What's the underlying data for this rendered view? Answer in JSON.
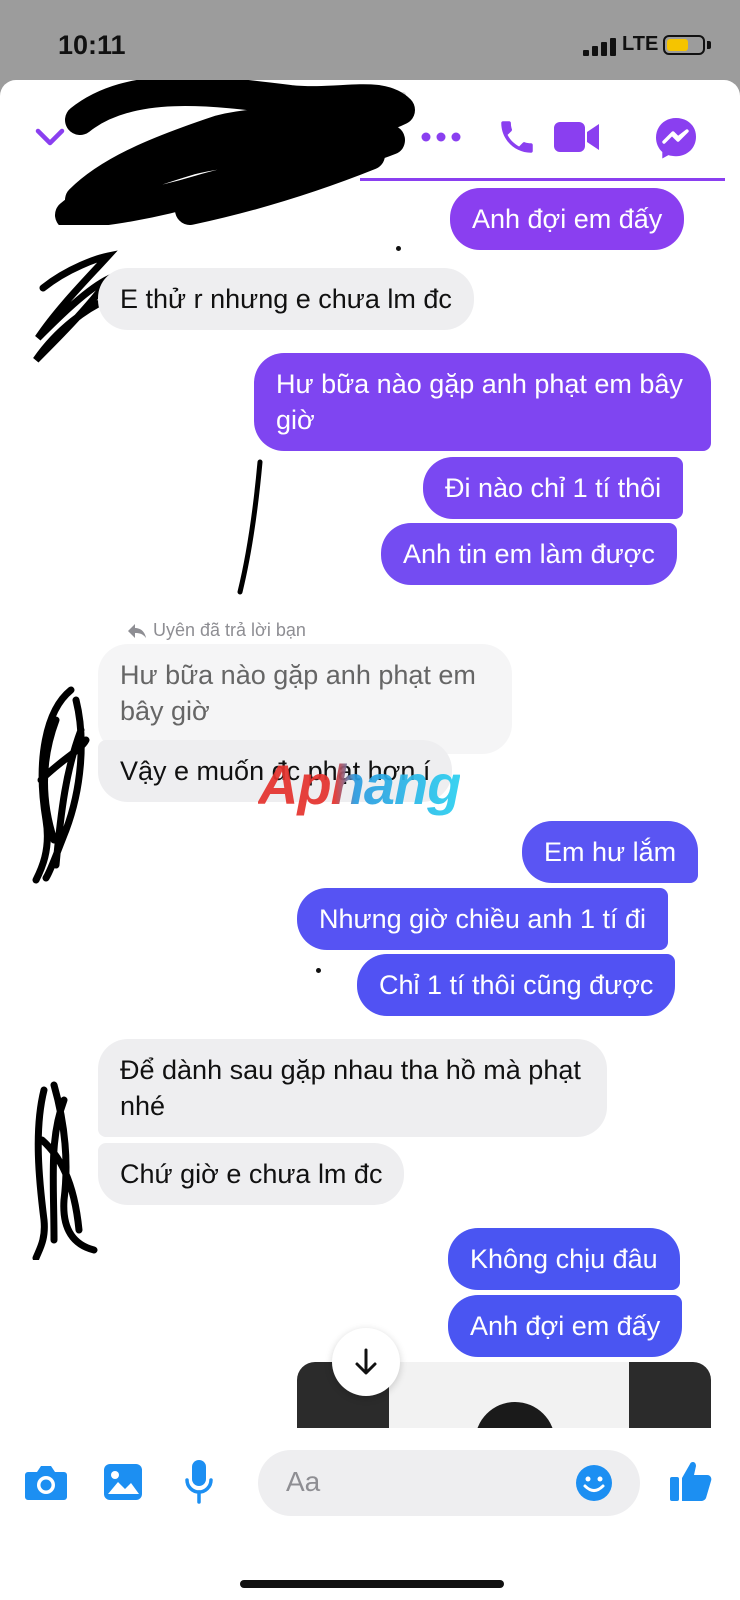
{
  "status": {
    "time": "10:11",
    "network": "LTE"
  },
  "colors": {
    "accent": "#8a3ff0",
    "bubble_top": "#8a3ff0",
    "bubble_mid": "#7b4bf2",
    "bubble_low": "#4a55f2",
    "incoming_bg": "#eeeef0",
    "composer_icon": "#1c8ff2"
  },
  "header": {
    "icons": [
      "chevron-down-icon",
      "more-icon",
      "phone-icon",
      "video-icon",
      "messenger-icon"
    ]
  },
  "messages": [
    {
      "id": "m1",
      "dir": "out",
      "text": "Anh đợi em đấy"
    },
    {
      "id": "m2",
      "dir": "in",
      "text": "E thử r nhưng e chưa lm đc"
    },
    {
      "id": "m3",
      "dir": "out",
      "text": "Hư bữa nào gặp anh phạt em bây giờ"
    },
    {
      "id": "m4",
      "dir": "out",
      "text": "Đi nào chỉ 1 tí thôi"
    },
    {
      "id": "m5",
      "dir": "out",
      "text": "Anh tin em làm được"
    },
    {
      "id": "m6",
      "dir": "in",
      "text": "Vậy e muốn đc phạt hơn í"
    },
    {
      "id": "m7",
      "dir": "out",
      "text": "Em hư lắm"
    },
    {
      "id": "m8",
      "dir": "out",
      "text": "Nhưng giờ chiều anh 1 tí đi"
    },
    {
      "id": "m9",
      "dir": "out",
      "text": "Chỉ 1 tí thôi cũng được"
    },
    {
      "id": "m10",
      "dir": "in",
      "text": "Để dành sau gặp nhau tha hồ mà phạt nhé"
    },
    {
      "id": "m11",
      "dir": "in",
      "text": "Chứ giờ e chưa lm đc"
    },
    {
      "id": "m12",
      "dir": "out",
      "text": "Không chịu đâu"
    },
    {
      "id": "m13",
      "dir": "out",
      "text": "Anh đợi em đấy"
    }
  ],
  "reply": {
    "note": "Uyên đã trả lời bạn",
    "quoted_text": "Hư bữa nào gặp anh phạt em bây giờ"
  },
  "watermark": "Aphang",
  "composer": {
    "placeholder": "Aa",
    "icons": [
      "camera-icon",
      "image-icon",
      "microphone-icon",
      "emoji-icon",
      "thumbs-up-icon"
    ]
  },
  "scroll_button_icon": "arrow-down-icon"
}
